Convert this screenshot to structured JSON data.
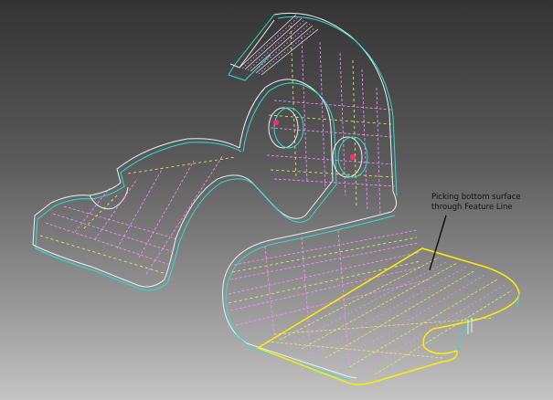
{
  "annotation": {
    "text": "Picking bottom surface through Feature Line"
  },
  "colors": {
    "edge_cyan": "#2ee0d0",
    "edge_white": "#f0f0f0",
    "isoline_magenta": "#ff8cff",
    "isoline_yellow": "#f5f060",
    "highlight_yellow": "#ffee00",
    "hole_marker": "#ff2a7a",
    "leader_line": "#000000"
  },
  "icons": {
    "model": "sheet-metal-bracket-wireframe",
    "highlight": "selected-surface-outline"
  }
}
